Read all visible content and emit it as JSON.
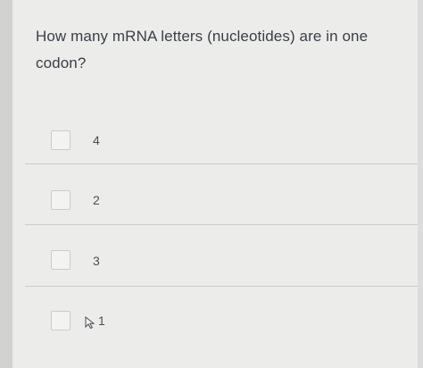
{
  "question": {
    "text": "How many mRNA letters (nucleotides) are in one codon?"
  },
  "options": [
    {
      "label": "4",
      "checked": false
    },
    {
      "label": "2",
      "checked": false
    },
    {
      "label": "3",
      "checked": false
    },
    {
      "label": "1",
      "checked": false
    }
  ],
  "cursor": {
    "icon": "pointer-cursor-icon"
  }
}
